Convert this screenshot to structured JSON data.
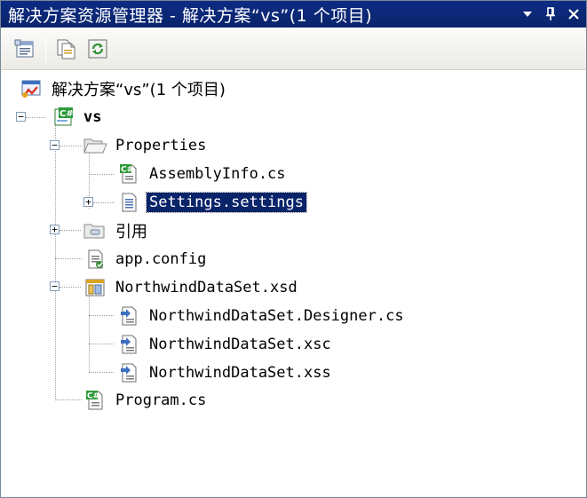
{
  "window": {
    "title": "解决方案资源管理器 - 解决方案“vs”(1 个项目)"
  },
  "tree": {
    "solution": "解决方案“vs”(1 个项目)",
    "project": "vs",
    "properties": "Properties",
    "assemblyinfo": "AssemblyInfo.cs",
    "settings": "Settings.settings",
    "references": "引用",
    "appconfig": "app.config",
    "dataset": "NorthwindDataSet.xsd",
    "designer": "NorthwindDataSet.Designer.cs",
    "xsc": "NorthwindDataSet.xsc",
    "xss": "NorthwindDataSet.xss",
    "program": "Program.cs"
  },
  "colors": {
    "titlebar": "#0a246a",
    "selection": "#0a246a"
  },
  "icons": {
    "toolbar": [
      "properties-icon",
      "show-all-files-icon",
      "refresh-icon"
    ]
  }
}
